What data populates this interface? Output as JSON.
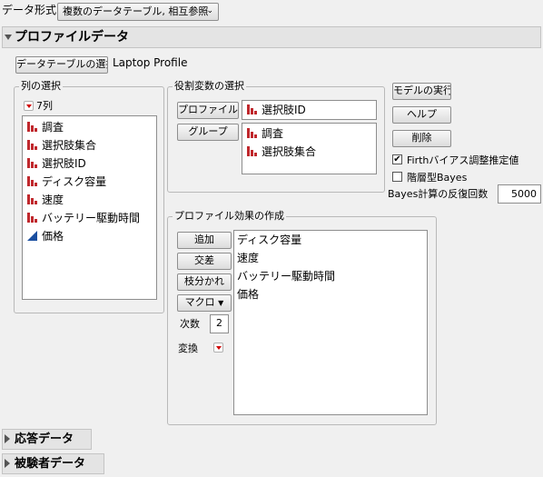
{
  "data_format": {
    "label": "データ形式",
    "selected": "複数のデータテーブル, 相互参照"
  },
  "profile_section": {
    "title": "プロファイルデータ",
    "select_table_button": "データテーブルの選択",
    "table_name": "Laptop Profile"
  },
  "column_selection": {
    "legend": "列の選択",
    "count": "7列",
    "columns": [
      {
        "label": "調査",
        "type": "nominal"
      },
      {
        "label": "選択肢集合",
        "type": "nominal"
      },
      {
        "label": "選択肢ID",
        "type": "nominal"
      },
      {
        "label": "ディスク容量",
        "type": "nominal"
      },
      {
        "label": "速度",
        "type": "nominal"
      },
      {
        "label": "バッテリー駆動時間",
        "type": "nominal"
      },
      {
        "label": "価格",
        "type": "continuous"
      }
    ]
  },
  "role_selection": {
    "legend": "役割変数の選択",
    "profile_id_button": "プロファイルID",
    "profile_id_value": "選択肢ID",
    "group_button": "グループ",
    "group_values": [
      "調査",
      "選択肢集合"
    ]
  },
  "action_buttons": {
    "run_model": "モデルの実行",
    "help": "ヘルプ",
    "remove": "削除"
  },
  "options": {
    "firth_label": "Firthバイアス調整推定値",
    "firth_checked": true,
    "hierarchical_bayes_label": "階層型Bayes",
    "hierarchical_bayes_checked": false,
    "bayes_iterations_label": "Bayes計算の反復回数",
    "bayes_iterations_value": "5000"
  },
  "profile_effects": {
    "legend": "プロファイル効果の作成",
    "add_button": "追加",
    "cross_button": "交差",
    "nest_button": "枝分かれ",
    "macro_button": "マクロ",
    "degree_label": "次数",
    "degree_value": "2",
    "transform_label": "変換",
    "effects": [
      "ディスク容量",
      "速度",
      "バッテリー駆動時間",
      "価格"
    ]
  },
  "collapsed_sections": {
    "response_data": "応答データ",
    "subject_data": "被験者データ"
  },
  "colors": {
    "nominal_icon": "#c0282d",
    "continuous_icon": "#1a4fa0",
    "red_triangle": "#d00000"
  },
  "icons": {
    "nominal": "nominal-bar-icon",
    "continuous": "continuous-triangle-icon",
    "menu": "red-triangle-menu-icon"
  }
}
